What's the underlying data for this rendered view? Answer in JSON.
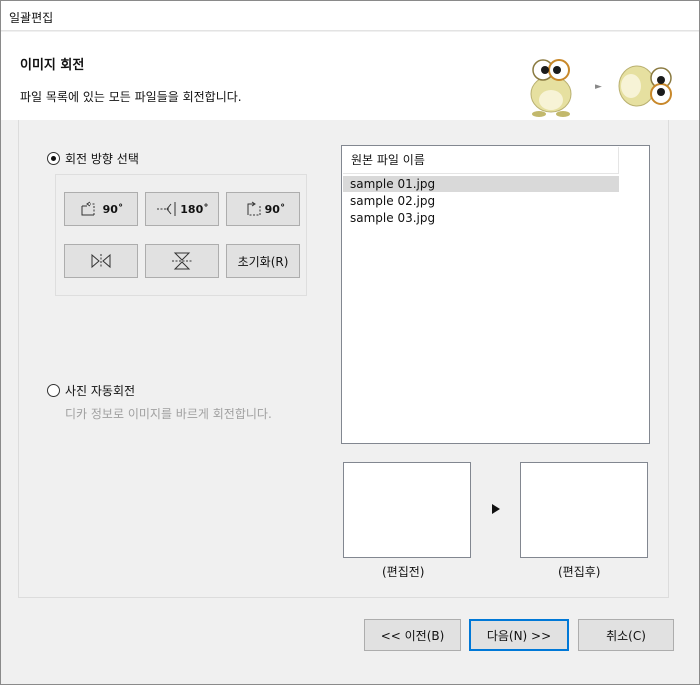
{
  "window": {
    "title": "일괄편집"
  },
  "header": {
    "title": "이미지 회전",
    "description": "파일 목록에 있는 모든 파일들을 회전합니다."
  },
  "rotation": {
    "option_label": "회전 방향 선택",
    "selected": true,
    "buttons": {
      "rotate_left_90": "90˚",
      "rotate_180": "180˚",
      "rotate_right_90": "90˚",
      "reset": "초기화(R)"
    }
  },
  "auto_rotate": {
    "option_label": "사진 자동회전",
    "description": "디카 정보로 이미지를 바르게 회전합니다.",
    "selected": false
  },
  "file_list": {
    "header": "원본 파일 이름",
    "items": [
      {
        "name": "sample 01.jpg",
        "selected": true
      },
      {
        "name": "sample 02.jpg",
        "selected": false
      },
      {
        "name": "sample 03.jpg",
        "selected": false
      }
    ]
  },
  "preview": {
    "before_label": "(편집전)",
    "after_label": "(편집후)"
  },
  "footer": {
    "back_label": "<< 이전(B)",
    "next_label": "다음(N) >>",
    "cancel_label": "취소(C)"
  }
}
